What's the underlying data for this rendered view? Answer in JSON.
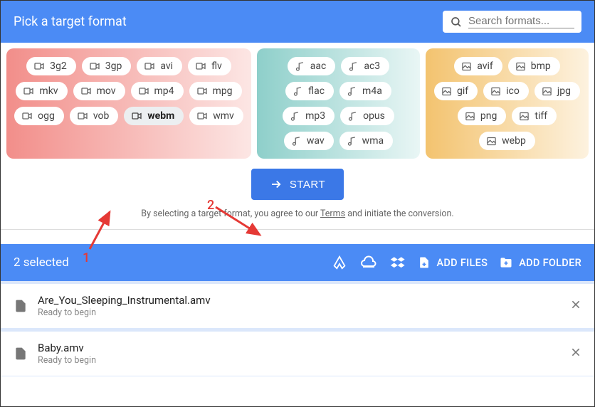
{
  "header": {
    "title": "Pick a target format",
    "search_placeholder": "Search formats..."
  },
  "groups": {
    "video": {
      "icon": "video-icon",
      "formats": [
        "3g2",
        "3gp",
        "avi",
        "flv",
        "mkv",
        "mov",
        "mp4",
        "mpg",
        "ogg",
        "vob",
        "webm",
        "wmv"
      ],
      "selected": "webm"
    },
    "audio": {
      "icon": "music-icon",
      "formats": [
        "aac",
        "ac3",
        "flac",
        "m4a",
        "mp3",
        "opus",
        "wav",
        "wma"
      ]
    },
    "image": {
      "icon": "image-icon",
      "formats": [
        "avif",
        "bmp",
        "gif",
        "ico",
        "jpg",
        "png",
        "tiff",
        "webp"
      ]
    }
  },
  "start_label": "START",
  "terms": {
    "prefix": "By selecting a target format, you agree to our ",
    "link": "Terms",
    "suffix": " and initiate the conversion."
  },
  "selection_bar": {
    "count_label": "2 selected",
    "add_files": "ADD FILES",
    "add_folder": "ADD FOLDER"
  },
  "files": [
    {
      "name": "Are_You_Sleeping_Instrumental.amv",
      "status": "Ready to begin"
    },
    {
      "name": "Baby.amv",
      "status": "Ready to begin"
    }
  ],
  "annotations": {
    "a1": "1",
    "a2": "2"
  }
}
